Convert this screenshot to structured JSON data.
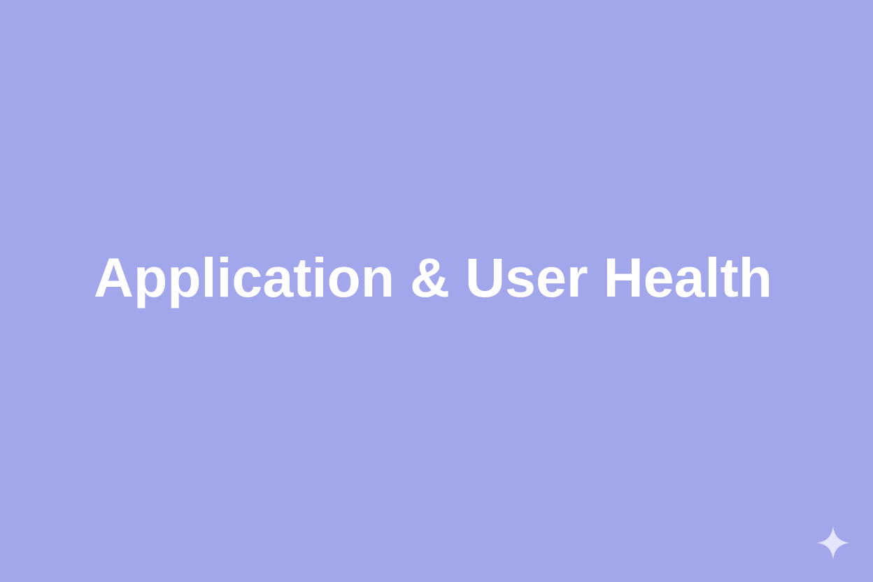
{
  "slide": {
    "title": "Application & User Health",
    "background_color": "#a2a7ec",
    "title_color": "#ffffff"
  },
  "watermark": {
    "icon": "sparkle-icon",
    "color": "#e4e6fb"
  }
}
